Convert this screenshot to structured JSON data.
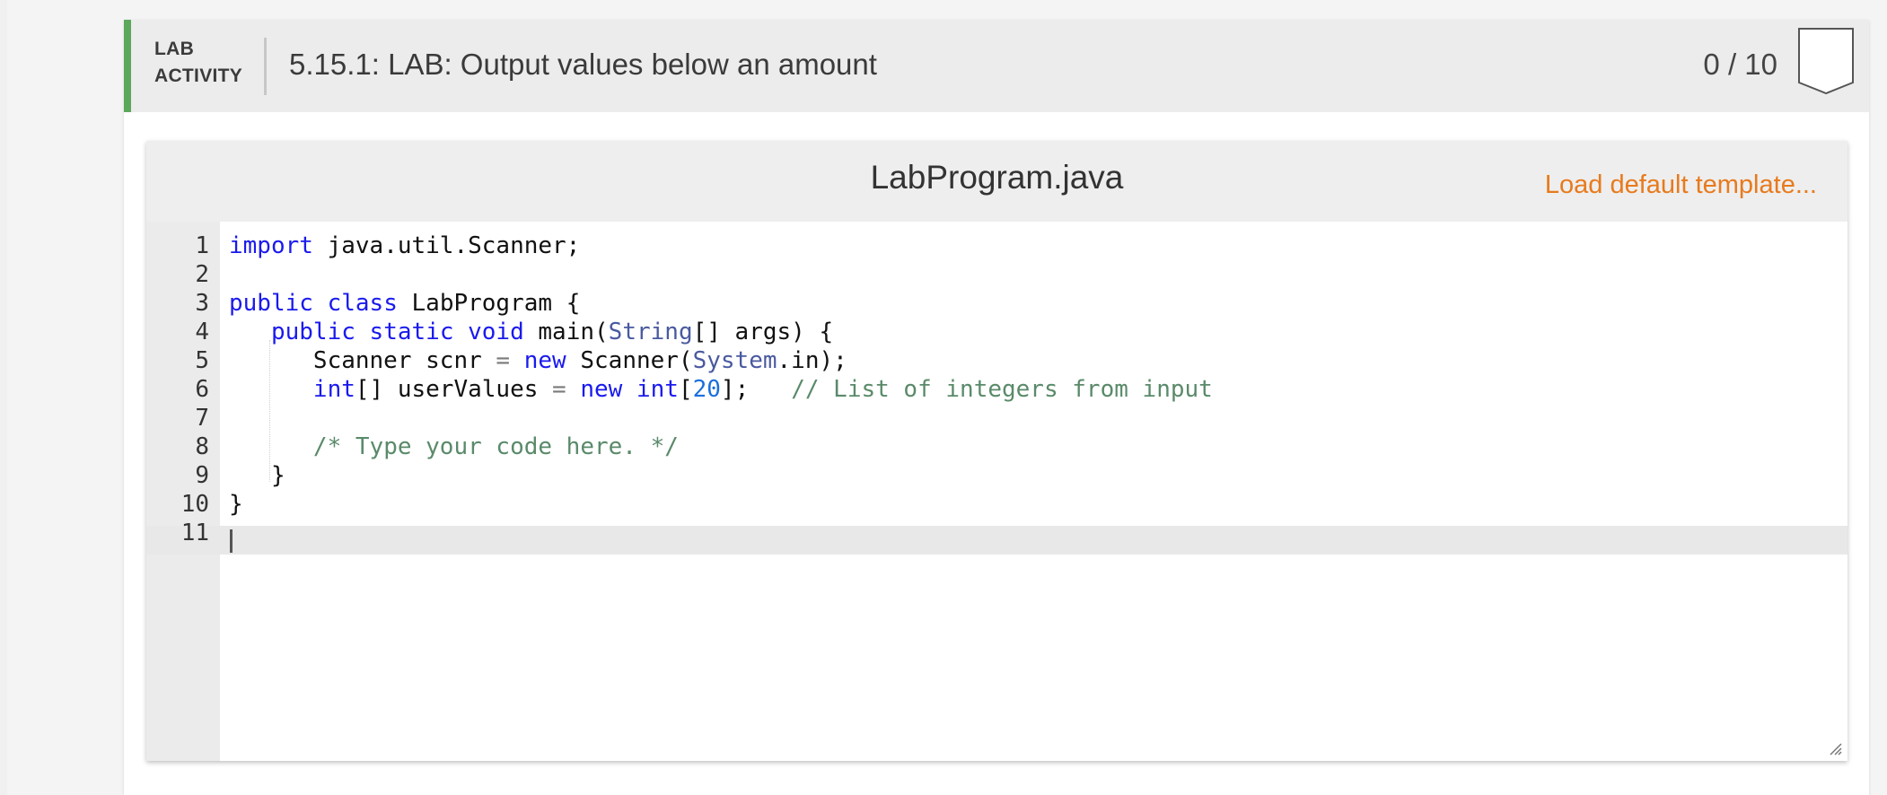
{
  "activity": {
    "type_line1": "LAB",
    "type_line2": "ACTIVITY",
    "title": "5.15.1: LAB: Output values below an amount",
    "score": "0 / 10",
    "accent_color": "#5ba85b"
  },
  "editor": {
    "file_name": "LabProgram.java",
    "load_template_label": "Load default template...",
    "link_color": "#e87a1d",
    "cursor_line": 11,
    "lines": [
      {
        "num": "1",
        "tokens": [
          {
            "t": "import",
            "c": "kw"
          },
          {
            "t": " java.util.Scanner;",
            "c": ""
          }
        ]
      },
      {
        "num": "2",
        "tokens": []
      },
      {
        "num": "3",
        "tokens": [
          {
            "t": "public",
            "c": "kw"
          },
          {
            "t": " ",
            "c": ""
          },
          {
            "t": "class",
            "c": "kw"
          },
          {
            "t": " LabProgram {",
            "c": ""
          }
        ]
      },
      {
        "num": "4",
        "tokens": [
          {
            "t": "   ",
            "c": ""
          },
          {
            "t": "public",
            "c": "kw"
          },
          {
            "t": " ",
            "c": ""
          },
          {
            "t": "static",
            "c": "kw"
          },
          {
            "t": " ",
            "c": ""
          },
          {
            "t": "void",
            "c": "kw"
          },
          {
            "t": " main(",
            "c": ""
          },
          {
            "t": "String",
            "c": "builtin"
          },
          {
            "t": "[] args) {",
            "c": ""
          }
        ]
      },
      {
        "num": "5",
        "tokens": [
          {
            "t": "      Scanner scnr ",
            "c": ""
          },
          {
            "t": "=",
            "c": "op"
          },
          {
            "t": " ",
            "c": ""
          },
          {
            "t": "new",
            "c": "kw"
          },
          {
            "t": " Scanner(",
            "c": ""
          },
          {
            "t": "System",
            "c": "builtin"
          },
          {
            "t": ".in);",
            "c": ""
          }
        ]
      },
      {
        "num": "6",
        "tokens": [
          {
            "t": "      ",
            "c": ""
          },
          {
            "t": "int",
            "c": "type"
          },
          {
            "t": "[] userValues ",
            "c": ""
          },
          {
            "t": "=",
            "c": "op"
          },
          {
            "t": " ",
            "c": ""
          },
          {
            "t": "new",
            "c": "kw"
          },
          {
            "t": " ",
            "c": ""
          },
          {
            "t": "int",
            "c": "type"
          },
          {
            "t": "[",
            "c": ""
          },
          {
            "t": "20",
            "c": "num"
          },
          {
            "t": "];   ",
            "c": ""
          },
          {
            "t": "// List of integers from input",
            "c": "comment"
          }
        ]
      },
      {
        "num": "7",
        "tokens": []
      },
      {
        "num": "8",
        "tokens": [
          {
            "t": "      ",
            "c": ""
          },
          {
            "t": "/* Type your code here. */",
            "c": "comment"
          }
        ]
      },
      {
        "num": "9",
        "tokens": [
          {
            "t": "   }",
            "c": ""
          }
        ]
      },
      {
        "num": "10",
        "tokens": [
          {
            "t": "}",
            "c": ""
          }
        ]
      },
      {
        "num": "11",
        "tokens": []
      }
    ]
  }
}
